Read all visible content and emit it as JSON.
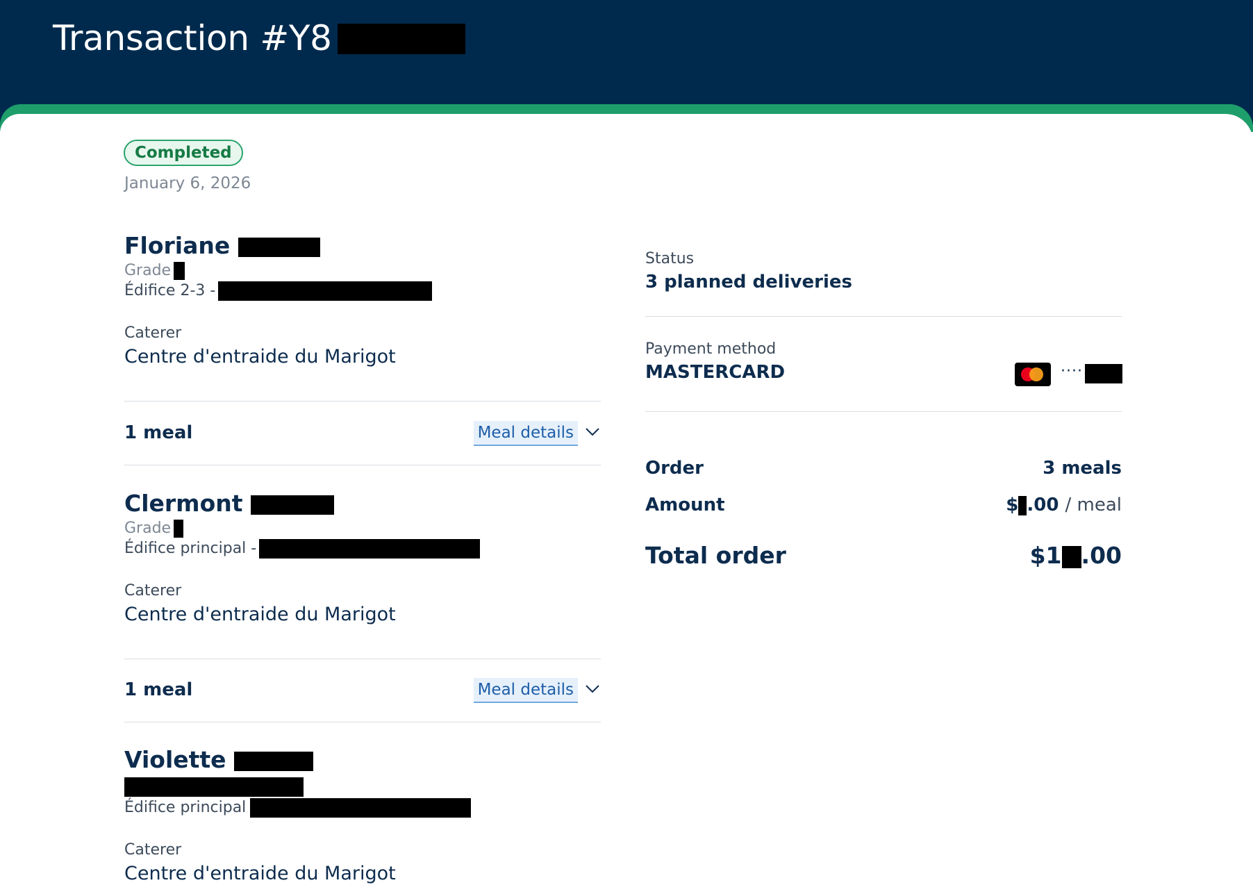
{
  "header": {
    "title_prefix": "Transaction #Y8"
  },
  "status_badge": "Completed",
  "date": "January 6, 2026",
  "students": [
    {
      "first_name": "Floriane",
      "grade_label": "Grade",
      "building": "Édifice 2-3 -",
      "caterer_label": "Caterer",
      "caterer": "Centre d'entraide du Marigot",
      "meal_count": "1 meal",
      "meal_details": "Meal details"
    },
    {
      "first_name": "Clermont",
      "grade_label": "Grade",
      "building": "Édifice principal -",
      "caterer_label": "Caterer",
      "caterer": "Centre d'entraide du Marigot",
      "meal_count": "1 meal",
      "meal_details": "Meal details"
    },
    {
      "first_name": "Violette",
      "grade_label": "",
      "building": "Édifice principal",
      "caterer_label": "Caterer",
      "caterer": "Centre d'entraide du Marigot"
    }
  ],
  "summary": {
    "status_label": "Status",
    "status_value": "3 planned deliveries",
    "payment_label": "Payment method",
    "payment_value": "MASTERCARD",
    "card_mask": "····",
    "card_brand_icon": "mastercard-icon",
    "order_label": "Order",
    "order_value": "3 meals",
    "amount_label": "Amount",
    "amount_prefix": "$",
    "amount_suffix": ".00",
    "amount_unit": "/ meal",
    "total_label": "Total order",
    "total_prefix": "$1",
    "total_suffix": ".00"
  },
  "colors": {
    "header_bg": "#002a4d",
    "accent_green": "#1e9e6b",
    "link_blue": "#1d5ea8"
  }
}
